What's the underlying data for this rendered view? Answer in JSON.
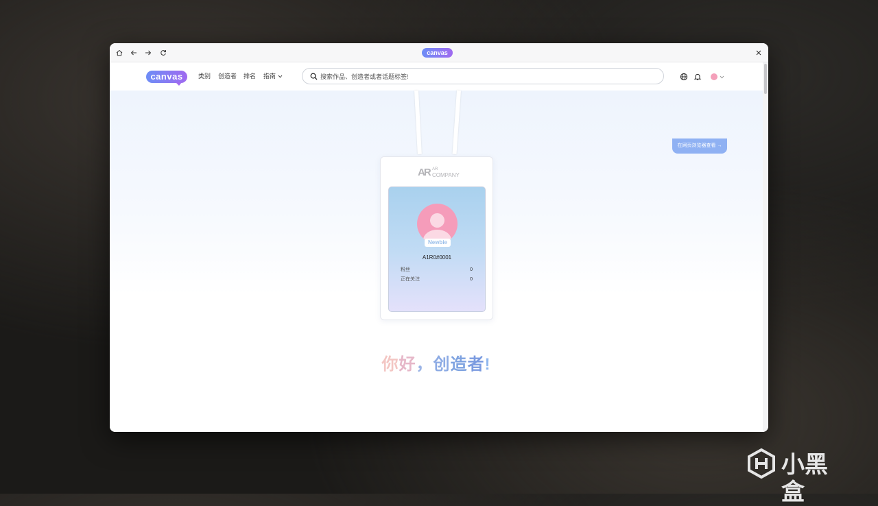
{
  "browser": {
    "logo_text": "canvas",
    "icons": [
      "home-icon",
      "back-arrow-icon",
      "forward-arrow-icon",
      "reload-icon",
      "close-icon"
    ]
  },
  "navbar": {
    "logo_text": "canvas",
    "links": [
      "类别",
      "创造者",
      "排名",
      "指南"
    ],
    "search_placeholder": "搜索作品、创造者或者话题标签!",
    "icons": [
      "globe-icon",
      "bell-icon",
      "avatar",
      "chevron-down-icon"
    ]
  },
  "banner": {
    "view_in_browser": "在网页浏览器查看 →"
  },
  "id_card": {
    "company_line1": "AR",
    "company_line2": "COMPANY",
    "badge": "Newbie",
    "user_id": "A1R0#0001",
    "stats": [
      {
        "label": "粉丝",
        "value": "0"
      },
      {
        "label": "正在关注",
        "value": "0"
      }
    ]
  },
  "greeting": {
    "chars": [
      "你",
      "好",
      "，",
      "创",
      "造",
      "者",
      "!"
    ]
  },
  "watermark": {
    "text": "小黑盒"
  },
  "colors": {
    "brand_gradient_start": "#6d8df6",
    "brand_gradient_end": "#a06af0",
    "avatar_pink": "#f59cba",
    "view_button": "#8fb1f3"
  }
}
